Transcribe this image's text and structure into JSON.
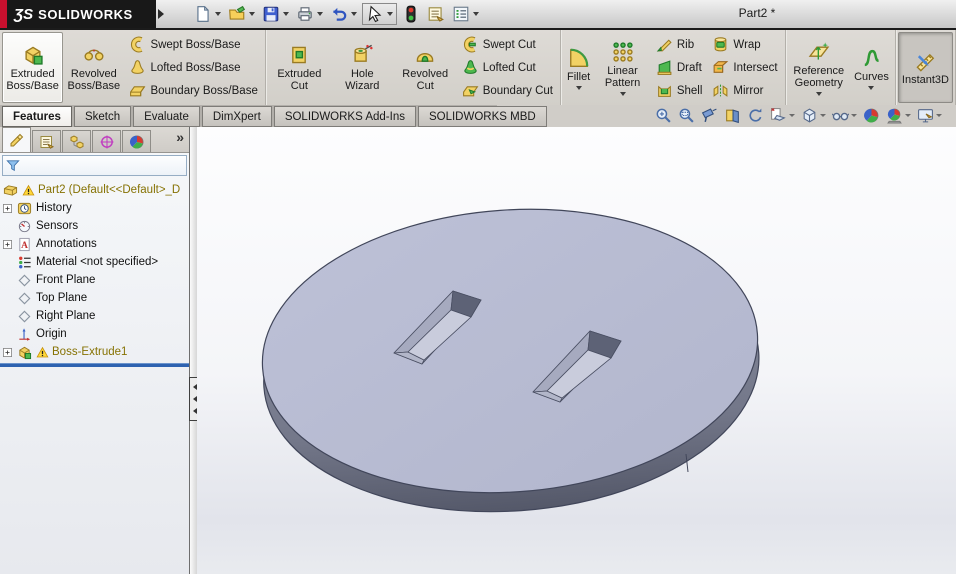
{
  "titlebar": {
    "brand_mark": "ƷS",
    "brand_name": "SOLIDWORKS",
    "document_title": "Part2 *",
    "tools": [
      {
        "name": "new-document",
        "dropdown": true
      },
      {
        "name": "open",
        "dropdown": true
      },
      {
        "name": "save",
        "dropdown": true
      },
      {
        "name": "print",
        "dropdown": true
      },
      {
        "name": "undo",
        "dropdown": true
      },
      {
        "name": "select",
        "dropdown": true,
        "boxed": true
      },
      {
        "name": "rebuild"
      },
      {
        "name": "file-properties"
      },
      {
        "name": "options",
        "dropdown": true
      }
    ]
  },
  "ribbon": {
    "groups": [
      {
        "name": "boss-base",
        "large": [
          {
            "label": "Extruded Boss/Base",
            "icon": "extruded-boss",
            "active": true
          },
          {
            "label": "Revolved Boss/Base",
            "icon": "revolved-boss"
          }
        ],
        "stacks": [
          [
            {
              "label": "Swept Boss/Base",
              "icon": "swept-boss"
            },
            {
              "label": "Lofted Boss/Base",
              "icon": "lofted-boss"
            },
            {
              "label": "Boundary Boss/Base",
              "icon": "boundary-boss"
            }
          ]
        ]
      },
      {
        "name": "cut",
        "large": [
          {
            "label": "Extruded Cut",
            "icon": "extruded-cut"
          },
          {
            "label": "Hole Wizard",
            "icon": "hole-wizard"
          },
          {
            "label": "Revolved Cut",
            "icon": "revolved-cut"
          }
        ],
        "stacks": [
          [
            {
              "label": "Swept Cut",
              "icon": "swept-cut"
            },
            {
              "label": "Lofted Cut",
              "icon": "lofted-cut"
            },
            {
              "label": "Boundary Cut",
              "icon": "boundary-cut"
            }
          ]
        ]
      },
      {
        "name": "features",
        "large": [
          {
            "label": "Fillet",
            "icon": "fillet",
            "dropdown": true
          },
          {
            "label": "Linear Pattern",
            "icon": "linear-pattern",
            "dropdown": true
          }
        ],
        "stacks": [
          [
            {
              "label": "Rib",
              "icon": "rib"
            },
            {
              "label": "Draft",
              "icon": "draft"
            },
            {
              "label": "Shell",
              "icon": "shell"
            }
          ],
          [
            {
              "label": "Wrap",
              "icon": "wrap"
            },
            {
              "label": "Intersect",
              "icon": "intersect"
            },
            {
              "label": "Mirror",
              "icon": "mirror"
            }
          ]
        ]
      },
      {
        "name": "reference",
        "large": [
          {
            "label": "Reference Geometry",
            "icon": "reference-geometry",
            "dropdown": true
          },
          {
            "label": "Curves",
            "icon": "curves",
            "dropdown": true
          }
        ]
      },
      {
        "name": "instant3d",
        "large": [
          {
            "label": "Instant3D",
            "icon": "instant3d",
            "pressed": true
          }
        ]
      }
    ]
  },
  "tabs": [
    {
      "label": "Features",
      "active": true
    },
    {
      "label": "Sketch"
    },
    {
      "label": "Evaluate"
    },
    {
      "label": "DimXpert"
    },
    {
      "label": "SOLIDWORKS Add-Ins"
    },
    {
      "label": "SOLIDWORKS MBD"
    }
  ],
  "headsup": [
    {
      "name": "zoom-to-fit"
    },
    {
      "name": "zoom-to-area"
    },
    {
      "name": "previous-view"
    },
    {
      "name": "section-view"
    },
    {
      "name": "rotate-view"
    },
    {
      "name": "view-orientation",
      "dropdown": true
    },
    {
      "name": "display-style",
      "dropdown": true
    },
    {
      "name": "hide-show-items",
      "dropdown": true
    },
    {
      "name": "edit-appearance"
    },
    {
      "name": "apply-scene",
      "dropdown": true
    },
    {
      "name": "view-settings",
      "dropdown": true
    }
  ],
  "panel": {
    "tabs": [
      {
        "name": "featuremanager-tab",
        "icon": "featuremanager",
        "active": true
      },
      {
        "name": "propertymanager-tab",
        "icon": "propertymanager"
      },
      {
        "name": "configurationmanager-tab",
        "icon": "configurationmanager"
      },
      {
        "name": "dimxpertmanager-tab",
        "icon": "dimxpertmanager"
      },
      {
        "name": "displaymanager-tab",
        "icon": "displaymanager"
      }
    ],
    "chevron": "»"
  },
  "tree": {
    "items": [
      {
        "label": "Part2 (Default<<Default>_D",
        "icon": "part",
        "warning": true,
        "gold": true,
        "root": true
      },
      {
        "label": "History",
        "icon": "history",
        "expand": true
      },
      {
        "label": "Sensors",
        "icon": "sensors"
      },
      {
        "label": "Annotations",
        "icon": "annotations",
        "expand": true
      },
      {
        "label": "Material <not specified>",
        "icon": "material"
      },
      {
        "label": "Front Plane",
        "icon": "plane"
      },
      {
        "label": "Top Plane",
        "icon": "plane"
      },
      {
        "label": "Right Plane",
        "icon": "plane"
      },
      {
        "label": "Origin",
        "icon": "origin"
      },
      {
        "label": "Boss-Extrude1",
        "icon": "boss-extrude",
        "expand": true,
        "warning": true,
        "gold": true
      }
    ]
  },
  "colors": {
    "logo_red": "#c8102e",
    "titlebar_black": "#181818",
    "rollback_blue": "#2e62b0",
    "disc_top": "#b9bdd4",
    "disc_side_light": "#9196a8",
    "disc_side_dark": "#545869",
    "slot_floor": "#c9ccdc",
    "slot_far_wall": "#5d6276",
    "tree_warning_text": "#867203"
  }
}
